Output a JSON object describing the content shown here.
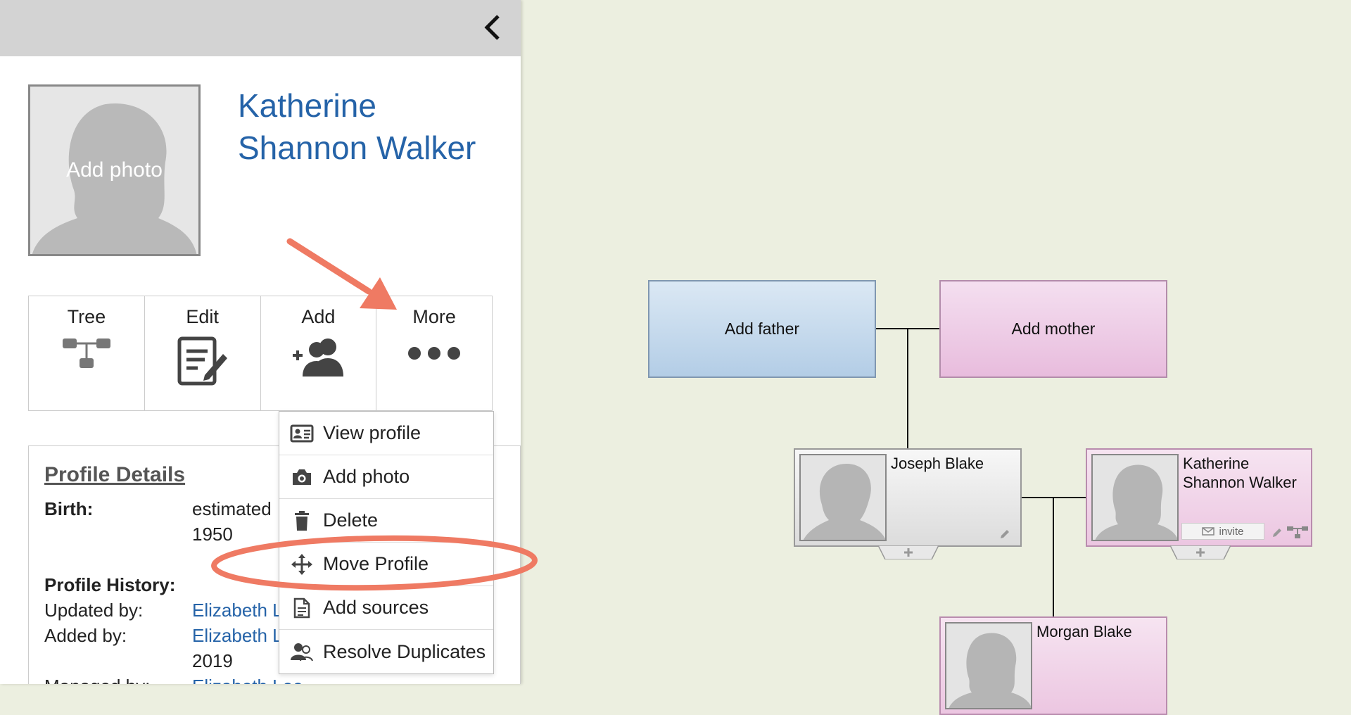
{
  "panel": {
    "collapse_icon": "chevron-left-icon",
    "photo_label": "Add photo",
    "name_line1": "Katherine",
    "name_line2": "Shannon Walker",
    "actions": [
      {
        "label": "Tree",
        "icon": "tree-icon"
      },
      {
        "label": "Edit",
        "icon": "edit-document-icon"
      },
      {
        "label": "Add",
        "icon": "add-person-icon"
      },
      {
        "label": "More",
        "icon": "more-dots-icon"
      }
    ],
    "details": {
      "title": "Profile Details",
      "birth_label": "Birth:",
      "birth_value_line1": "estimated",
      "birth_value_line2": "1950",
      "history_label": "Profile History:",
      "updated_label": "Updated by:",
      "updated_value": "Elizabeth L",
      "added_label": "Added by:",
      "added_value": "Elizabeth L",
      "added_year": "2019",
      "managed_label": "Managed by:",
      "managed_value": "Elizabeth Lee"
    }
  },
  "menu": {
    "items": [
      {
        "label": "View profile",
        "icon": "id-card-icon"
      },
      {
        "label": "Add photo",
        "icon": "camera-icon"
      },
      {
        "label": "Delete",
        "icon": "trash-icon"
      },
      {
        "label": "Move Profile",
        "icon": "move-arrows-icon"
      },
      {
        "label": "Add sources",
        "icon": "document-icon"
      },
      {
        "label": "Resolve Duplicates",
        "icon": "duplicate-people-icon"
      }
    ]
  },
  "tree": {
    "add_father": "Add father",
    "add_mother": "Add mother",
    "person_male": "Joseph Blake",
    "person_female_line1": "Katherine",
    "person_female_line2": "Shannon Walker",
    "invite_label": "invite",
    "child": "Morgan Blake"
  },
  "colors": {
    "link": "#2563a8",
    "annotation": "#ef7a63",
    "background": "#ecefe0"
  }
}
